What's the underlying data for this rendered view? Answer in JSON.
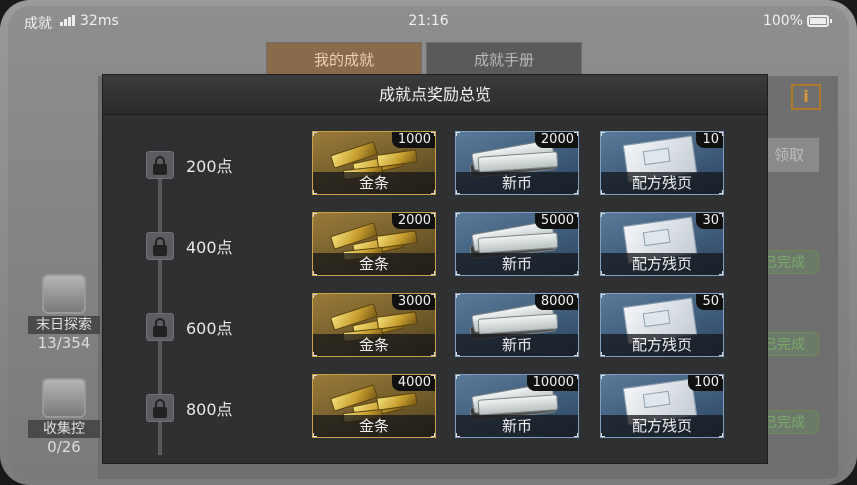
{
  "status_bar": {
    "carrier": "成就",
    "latency": "32ms",
    "time": "21:16",
    "battery": "100%"
  },
  "background": {
    "tabs": [
      {
        "label": "我的成就",
        "active": true
      },
      {
        "label": "成就手册",
        "active": false
      }
    ],
    "info_button": "i",
    "claim_label": "领取",
    "done_labels": [
      "已完成",
      "已完成",
      "已完成"
    ],
    "categories": [
      {
        "label": "末日探索",
        "count": "13/354"
      },
      {
        "label": "收集控",
        "count": "0/26"
      }
    ]
  },
  "modal": {
    "title": "成就点奖励总览",
    "tiers": [
      {
        "points": "200点",
        "rewards": [
          {
            "name": "金条",
            "qty": "1000",
            "kind": "gold"
          },
          {
            "name": "新币",
            "qty": "2000",
            "kind": "cash"
          },
          {
            "name": "配方残页",
            "qty": "10",
            "kind": "recipe"
          }
        ]
      },
      {
        "points": "400点",
        "rewards": [
          {
            "name": "金条",
            "qty": "2000",
            "kind": "gold"
          },
          {
            "name": "新币",
            "qty": "5000",
            "kind": "cash"
          },
          {
            "name": "配方残页",
            "qty": "30",
            "kind": "recipe"
          }
        ]
      },
      {
        "points": "600点",
        "rewards": [
          {
            "name": "金条",
            "qty": "3000",
            "kind": "gold"
          },
          {
            "name": "新币",
            "qty": "8000",
            "kind": "cash"
          },
          {
            "name": "配方残页",
            "qty": "50",
            "kind": "recipe"
          }
        ]
      },
      {
        "points": "800点",
        "rewards": [
          {
            "name": "金条",
            "qty": "4000",
            "kind": "gold"
          },
          {
            "name": "新币",
            "qty": "10000",
            "kind": "cash"
          },
          {
            "name": "配方残页",
            "qty": "100",
            "kind": "recipe"
          }
        ]
      }
    ]
  },
  "colors": {
    "modal_bg": "#2f3032",
    "gold_frame": "#c9a24a",
    "blue_frame": "#7fa0c0",
    "done_green": "#7aa86a",
    "info_orange": "#d89a3a"
  },
  "icons": {
    "signal": "signal-bars-icon",
    "battery": "battery-icon",
    "lock": "lock-icon",
    "gold": "gold-bars-icon",
    "cash": "cash-stack-icon",
    "recipe": "recipe-page-icon"
  }
}
